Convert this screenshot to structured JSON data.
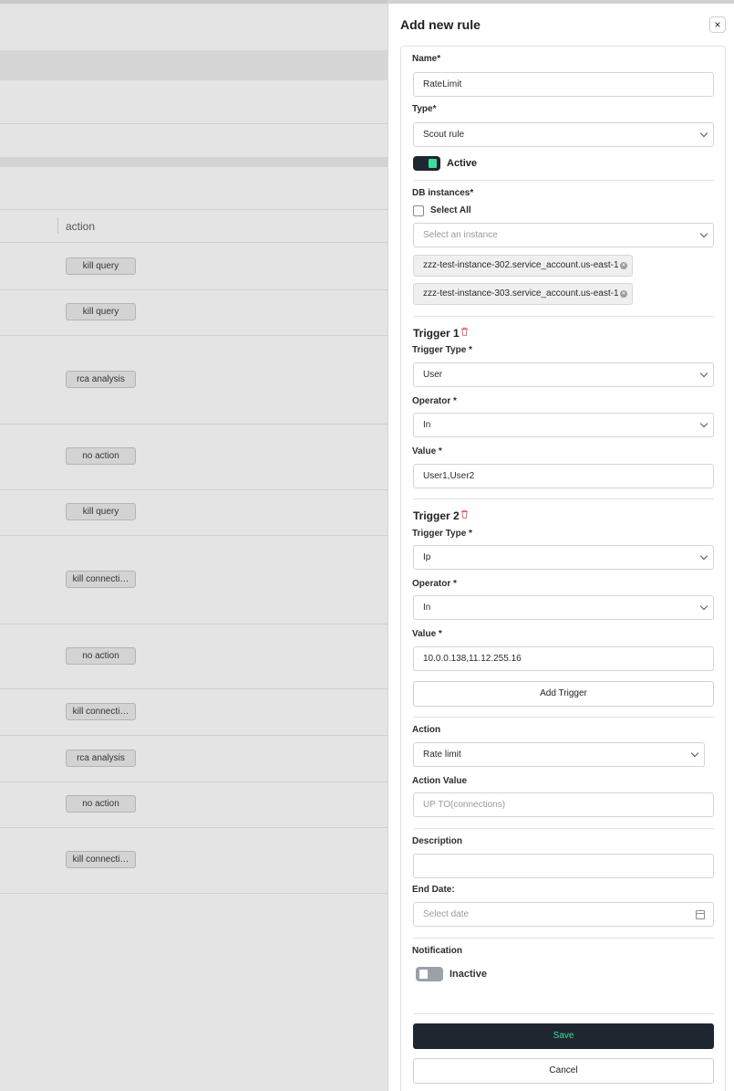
{
  "background": {
    "column_header": "action",
    "rows": [
      {
        "action": "kill query"
      },
      {
        "action": "kill query"
      },
      {
        "action": "rca analysis"
      },
      {
        "action": "no action"
      },
      {
        "action": "kill query"
      },
      {
        "action": "kill connecti…"
      },
      {
        "action": "no action"
      },
      {
        "action": "kill connecti…"
      },
      {
        "action": "rca analysis"
      },
      {
        "action": "no action"
      },
      {
        "action": "kill connecti…"
      }
    ]
  },
  "drawer": {
    "title": "Add new rule",
    "close_icon": "×",
    "name": {
      "label": "Name*",
      "value": "RateLimit"
    },
    "type": {
      "label": "Type*",
      "value": "Scout rule"
    },
    "active_toggle": {
      "label": "Active",
      "on": true
    },
    "db_instances": {
      "label": "DB instances*",
      "select_all_label": "Select All",
      "placeholder": "Select an instance",
      "selected": [
        "zzz-test-instance-302.service_account.us-east-1",
        "zzz-test-instance-303.service_account.us-east-1"
      ]
    },
    "triggers": [
      {
        "title": "Trigger 1",
        "type_label": "Trigger Type *",
        "type_value": "User",
        "operator_label": "Operator *",
        "operator_value": "In",
        "value_label": "Value *",
        "value": "User1,User2"
      },
      {
        "title": "Trigger 2",
        "type_label": "Trigger Type *",
        "type_value": "Ip",
        "operator_label": "Operator *",
        "operator_value": "In",
        "value_label": "Value *",
        "value": "10.0.0.138,11.12.255.16"
      }
    ],
    "add_trigger_label": "Add Trigger",
    "action": {
      "label": "Action",
      "value": "Rate limit"
    },
    "action_value": {
      "label": "Action Value",
      "placeholder": "UP TO(connections)"
    },
    "description": {
      "label": "Description",
      "value": ""
    },
    "end_date": {
      "label": "End Date:",
      "placeholder": "Select date"
    },
    "notification": {
      "label": "Notification",
      "toggle_label": "Inactive",
      "on": false
    },
    "save_label": "Save",
    "cancel_label": "Cancel",
    "colors": {
      "dark": "#1f2630",
      "accent": "#3fdca0",
      "danger": "#e05a5a"
    }
  }
}
